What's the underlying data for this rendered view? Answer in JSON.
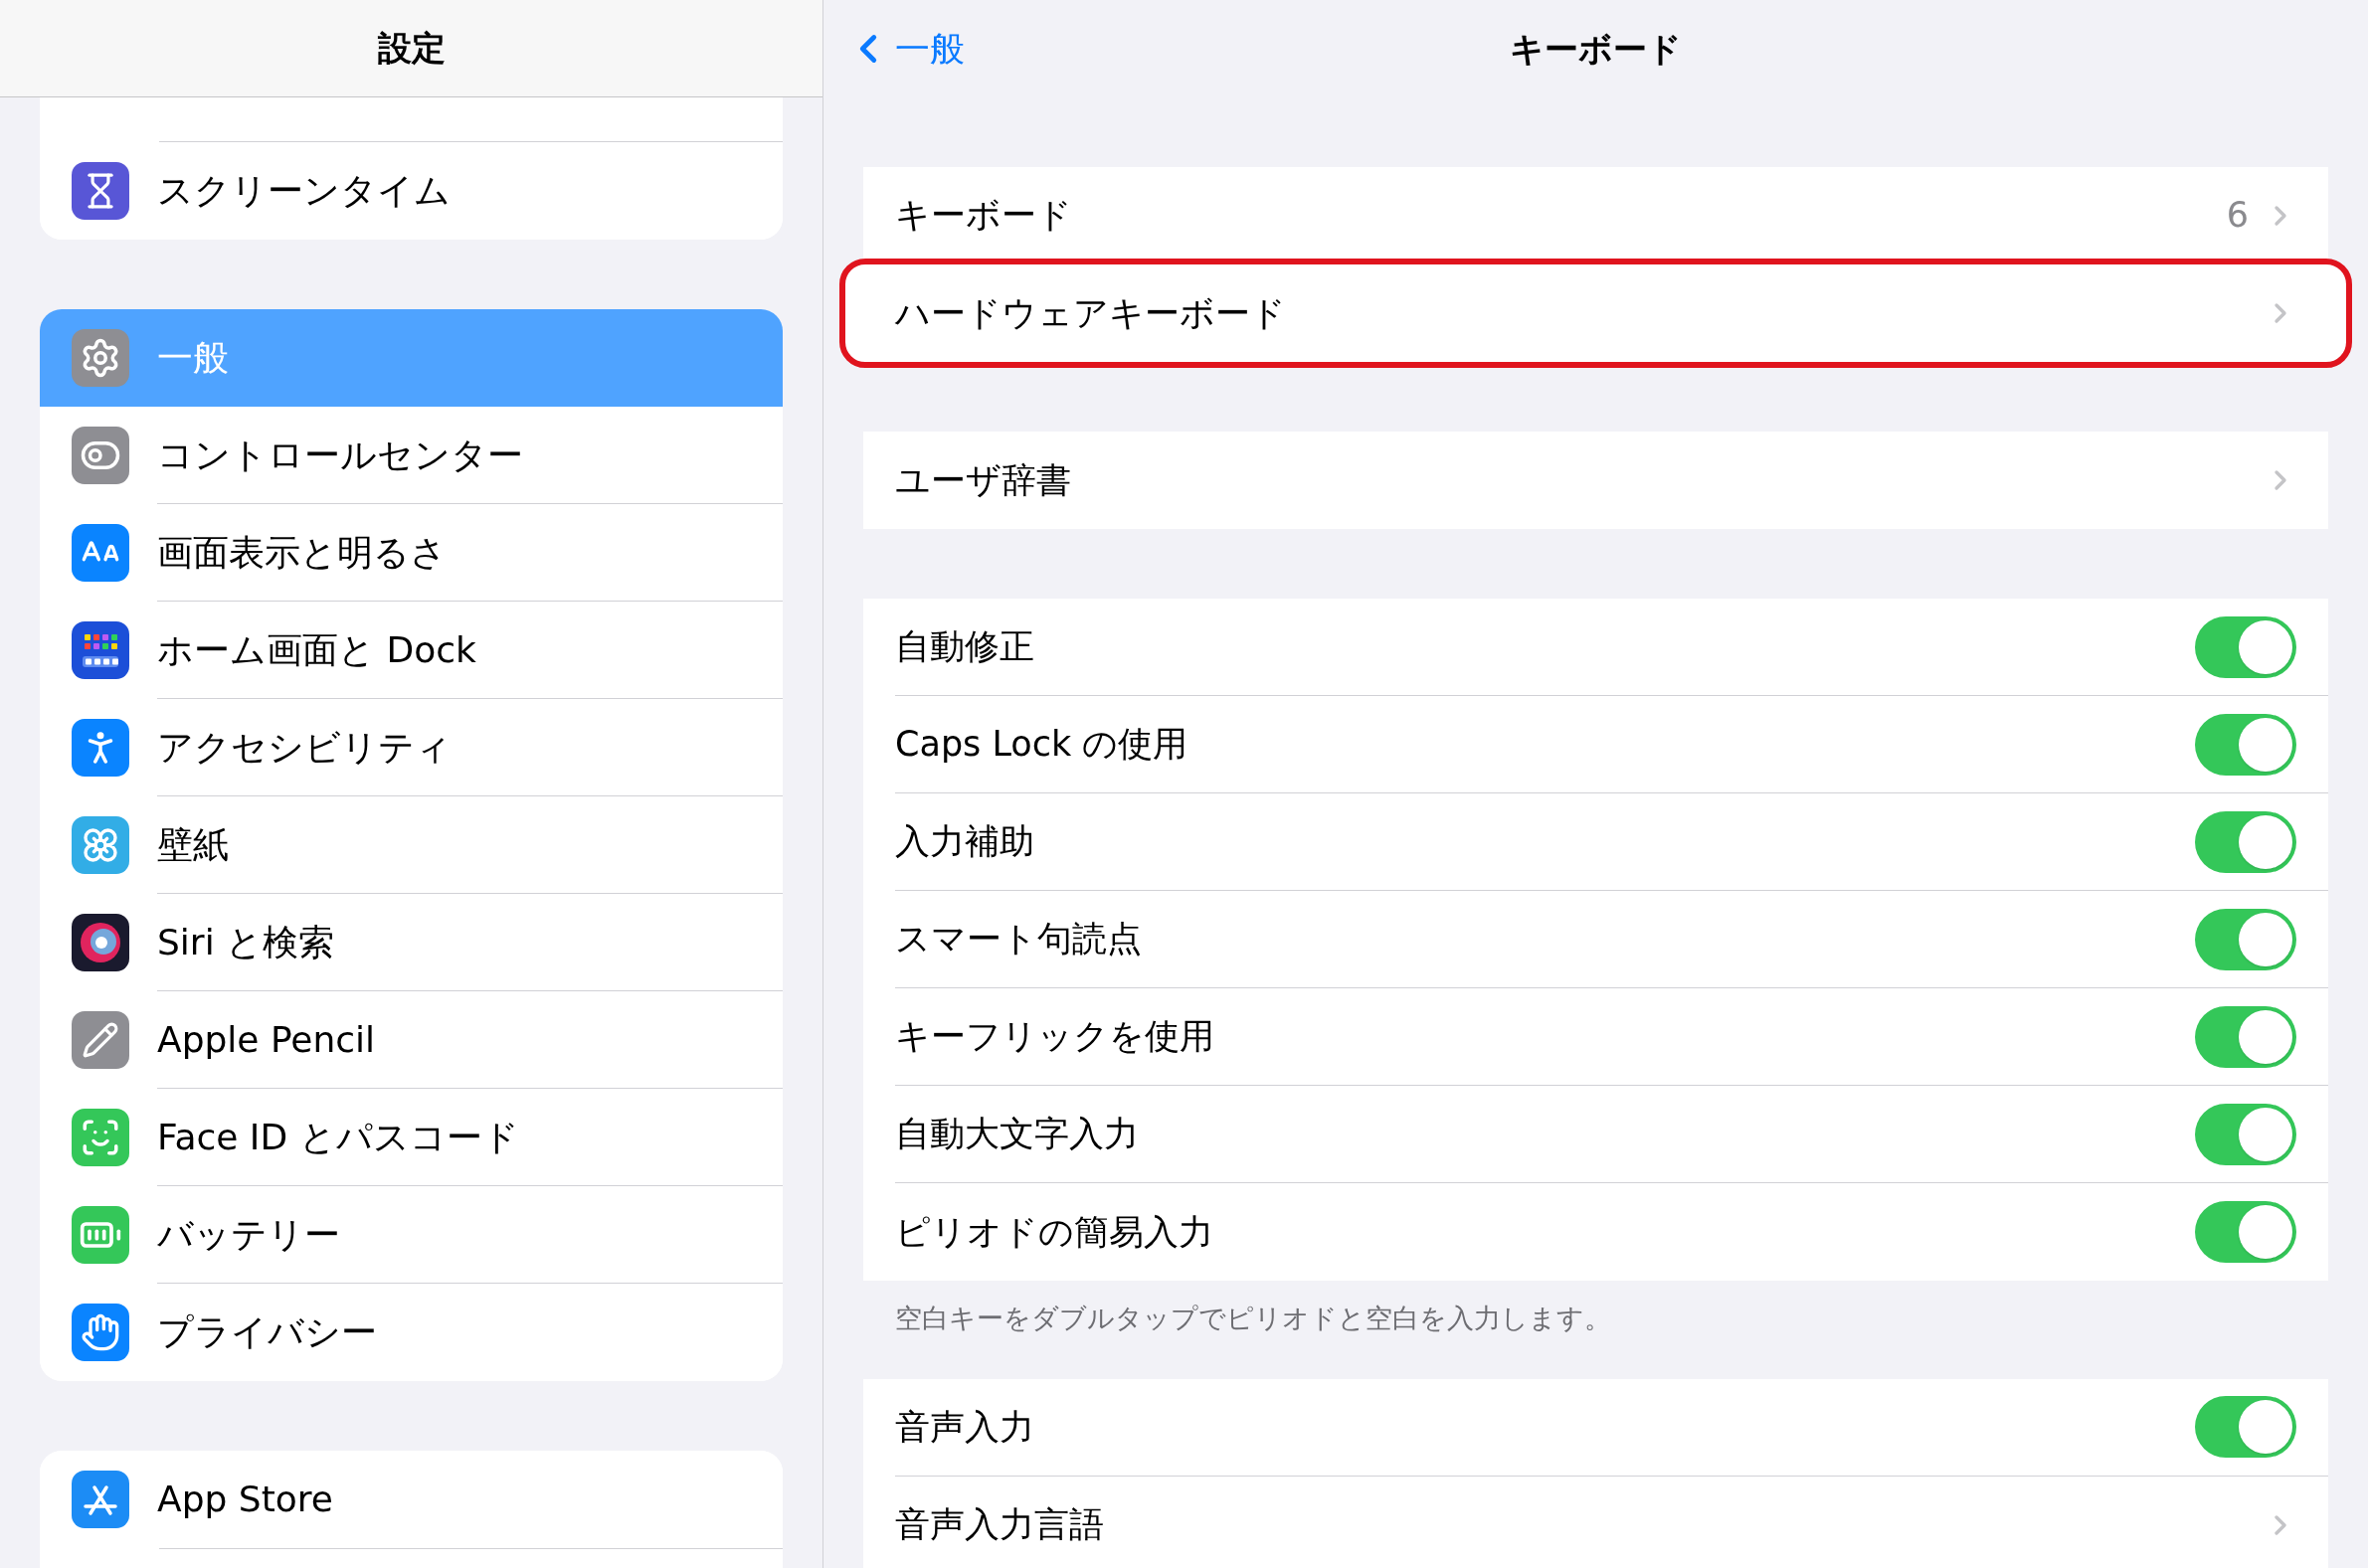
{
  "sidebar": {
    "title": "設定",
    "groups": [
      {
        "items": [
          {
            "kind": "screen-time",
            "label": "スクリーンタイム",
            "selected": false
          }
        ]
      },
      {
        "items": [
          {
            "kind": "general",
            "label": "一般",
            "selected": true
          },
          {
            "kind": "control-center",
            "label": "コントロールセンター",
            "selected": false
          },
          {
            "kind": "display",
            "label": "画面表示と明るさ",
            "selected": false
          },
          {
            "kind": "home-screen",
            "label": "ホーム画面と Dock",
            "selected": false
          },
          {
            "kind": "accessibility",
            "label": "アクセシビリティ",
            "selected": false
          },
          {
            "kind": "wallpaper",
            "label": "壁紙",
            "selected": false
          },
          {
            "kind": "siri",
            "label": "Siri と検索",
            "selected": false
          },
          {
            "kind": "pencil",
            "label": "Apple Pencil",
            "selected": false
          },
          {
            "kind": "face-id",
            "label": "Face ID とパスコード",
            "selected": false
          },
          {
            "kind": "battery",
            "label": "バッテリー",
            "selected": false
          },
          {
            "kind": "privacy",
            "label": "プライバシー",
            "selected": false
          }
        ]
      },
      {
        "items": [
          {
            "kind": "app-store",
            "label": "App Store",
            "selected": false
          }
        ]
      }
    ]
  },
  "detail": {
    "back": "一般",
    "title": "キーボード",
    "groups": [
      {
        "rows": [
          {
            "kind": "link",
            "label": "キーボード",
            "value": "6",
            "highlighted": false
          },
          {
            "kind": "link",
            "label": "ハードウェアキーボード",
            "highlighted": true
          }
        ]
      },
      {
        "rows": [
          {
            "kind": "link",
            "label": "ユーザ辞書",
            "highlighted": false
          }
        ]
      },
      {
        "rows": [
          {
            "kind": "toggle",
            "label": "自動修正",
            "on": true
          },
          {
            "kind": "toggle",
            "label": "Caps Lock の使用",
            "on": true
          },
          {
            "kind": "toggle",
            "label": "入力補助",
            "on": true
          },
          {
            "kind": "toggle",
            "label": "スマート句読点",
            "on": true
          },
          {
            "kind": "toggle",
            "label": "キーフリックを使用",
            "on": true
          },
          {
            "kind": "toggle",
            "label": "自動大文字入力",
            "on": true
          },
          {
            "kind": "toggle",
            "label": "ピリオドの簡易入力",
            "on": true
          }
        ],
        "footer": "空白キーをダブルタップでピリオドと空白を入力します。"
      },
      {
        "rows": [
          {
            "kind": "toggle",
            "label": "音声入力",
            "on": true
          },
          {
            "kind": "link",
            "label": "音声入力言語",
            "highlighted": false
          }
        ]
      }
    ]
  }
}
